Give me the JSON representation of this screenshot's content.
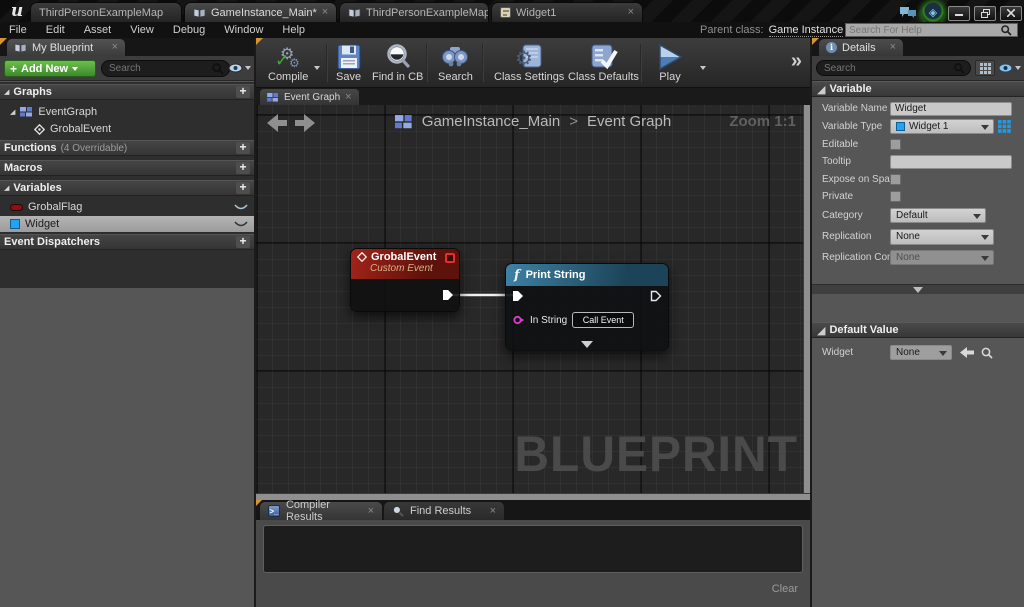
{
  "window": {
    "logo": "u",
    "tabs": [
      {
        "label": "ThirdPersonExampleMap"
      },
      {
        "label": "GameInstance_Main*"
      },
      {
        "label": "ThirdPersonExampleMap"
      },
      {
        "label": "Widget1"
      }
    ]
  },
  "menu": {
    "items": [
      "File",
      "Edit",
      "Asset",
      "View",
      "Debug",
      "Window",
      "Help"
    ],
    "parent_class_label": "Parent class:",
    "parent_class_value": "Game Instance",
    "help_search_placeholder": "Search For Help"
  },
  "toolbar": {
    "compile": "Compile",
    "save": "Save",
    "find_in_cb": "Find in CB",
    "search": "Search",
    "class_settings": "Class Settings",
    "class_defaults": "Class Defaults",
    "play": "Play",
    "overflow": "»"
  },
  "my_blueprint": {
    "tab": "My Blueprint",
    "add_new": "Add New",
    "search_placeholder": "Search",
    "graphs_header": "Graphs",
    "event_graph": "EventGraph",
    "grobal_event": "GrobalEvent",
    "functions_header": "Functions",
    "functions_note": "(4 Overridable)",
    "macros_header": "Macros",
    "variables_header": "Variables",
    "var_grobalflag": "GrobalFlag",
    "var_widget": "Widget",
    "event_dispatchers_header": "Event Dispatchers"
  },
  "graph": {
    "tab": "Event Graph",
    "breadcrumb_root": "GameInstance_Main",
    "breadcrumb_sep": ">",
    "breadcrumb_leaf": "Event Graph",
    "zoom_label": "Zoom 1:1",
    "watermark": "BLUEPRINT",
    "nodes": {
      "event": {
        "title": "GrobalEvent",
        "subtitle": "Custom Event"
      },
      "print": {
        "title": "Print String",
        "pin_label": "In String",
        "pin_value": "Call Event"
      }
    }
  },
  "details": {
    "tab": "Details",
    "search_placeholder": "Search",
    "variable_header": "Variable",
    "rows": {
      "variable_name_label": "Variable Name",
      "variable_name_value": "Widget",
      "variable_type_label": "Variable Type",
      "variable_type_value": "Widget 1",
      "editable_label": "Editable",
      "tooltip_label": "Tooltip",
      "expose_label": "Expose on Spawn",
      "private_label": "Private",
      "category_label": "Category",
      "category_value": "Default",
      "replication_label": "Replication",
      "replication_value": "None",
      "replication_cond_label": "Replication Condition",
      "replication_cond_value": "None"
    },
    "default_value_header": "Default Value",
    "default_widget_label": "Widget",
    "default_widget_value": "None"
  },
  "results": {
    "compiler_tab": "Compiler Results",
    "find_tab": "Find Results",
    "clear": "Clear"
  },
  "colors": {
    "accent_green": "#4f9e3c",
    "event_node_red": "#8d1f17",
    "function_node_blue": "#2d6e8e",
    "pin_magenta": "#e13bd0",
    "widget_blue": "#23a3f2",
    "bool_red": "#8e1111",
    "watermark_gray": "#4a4a4a"
  }
}
